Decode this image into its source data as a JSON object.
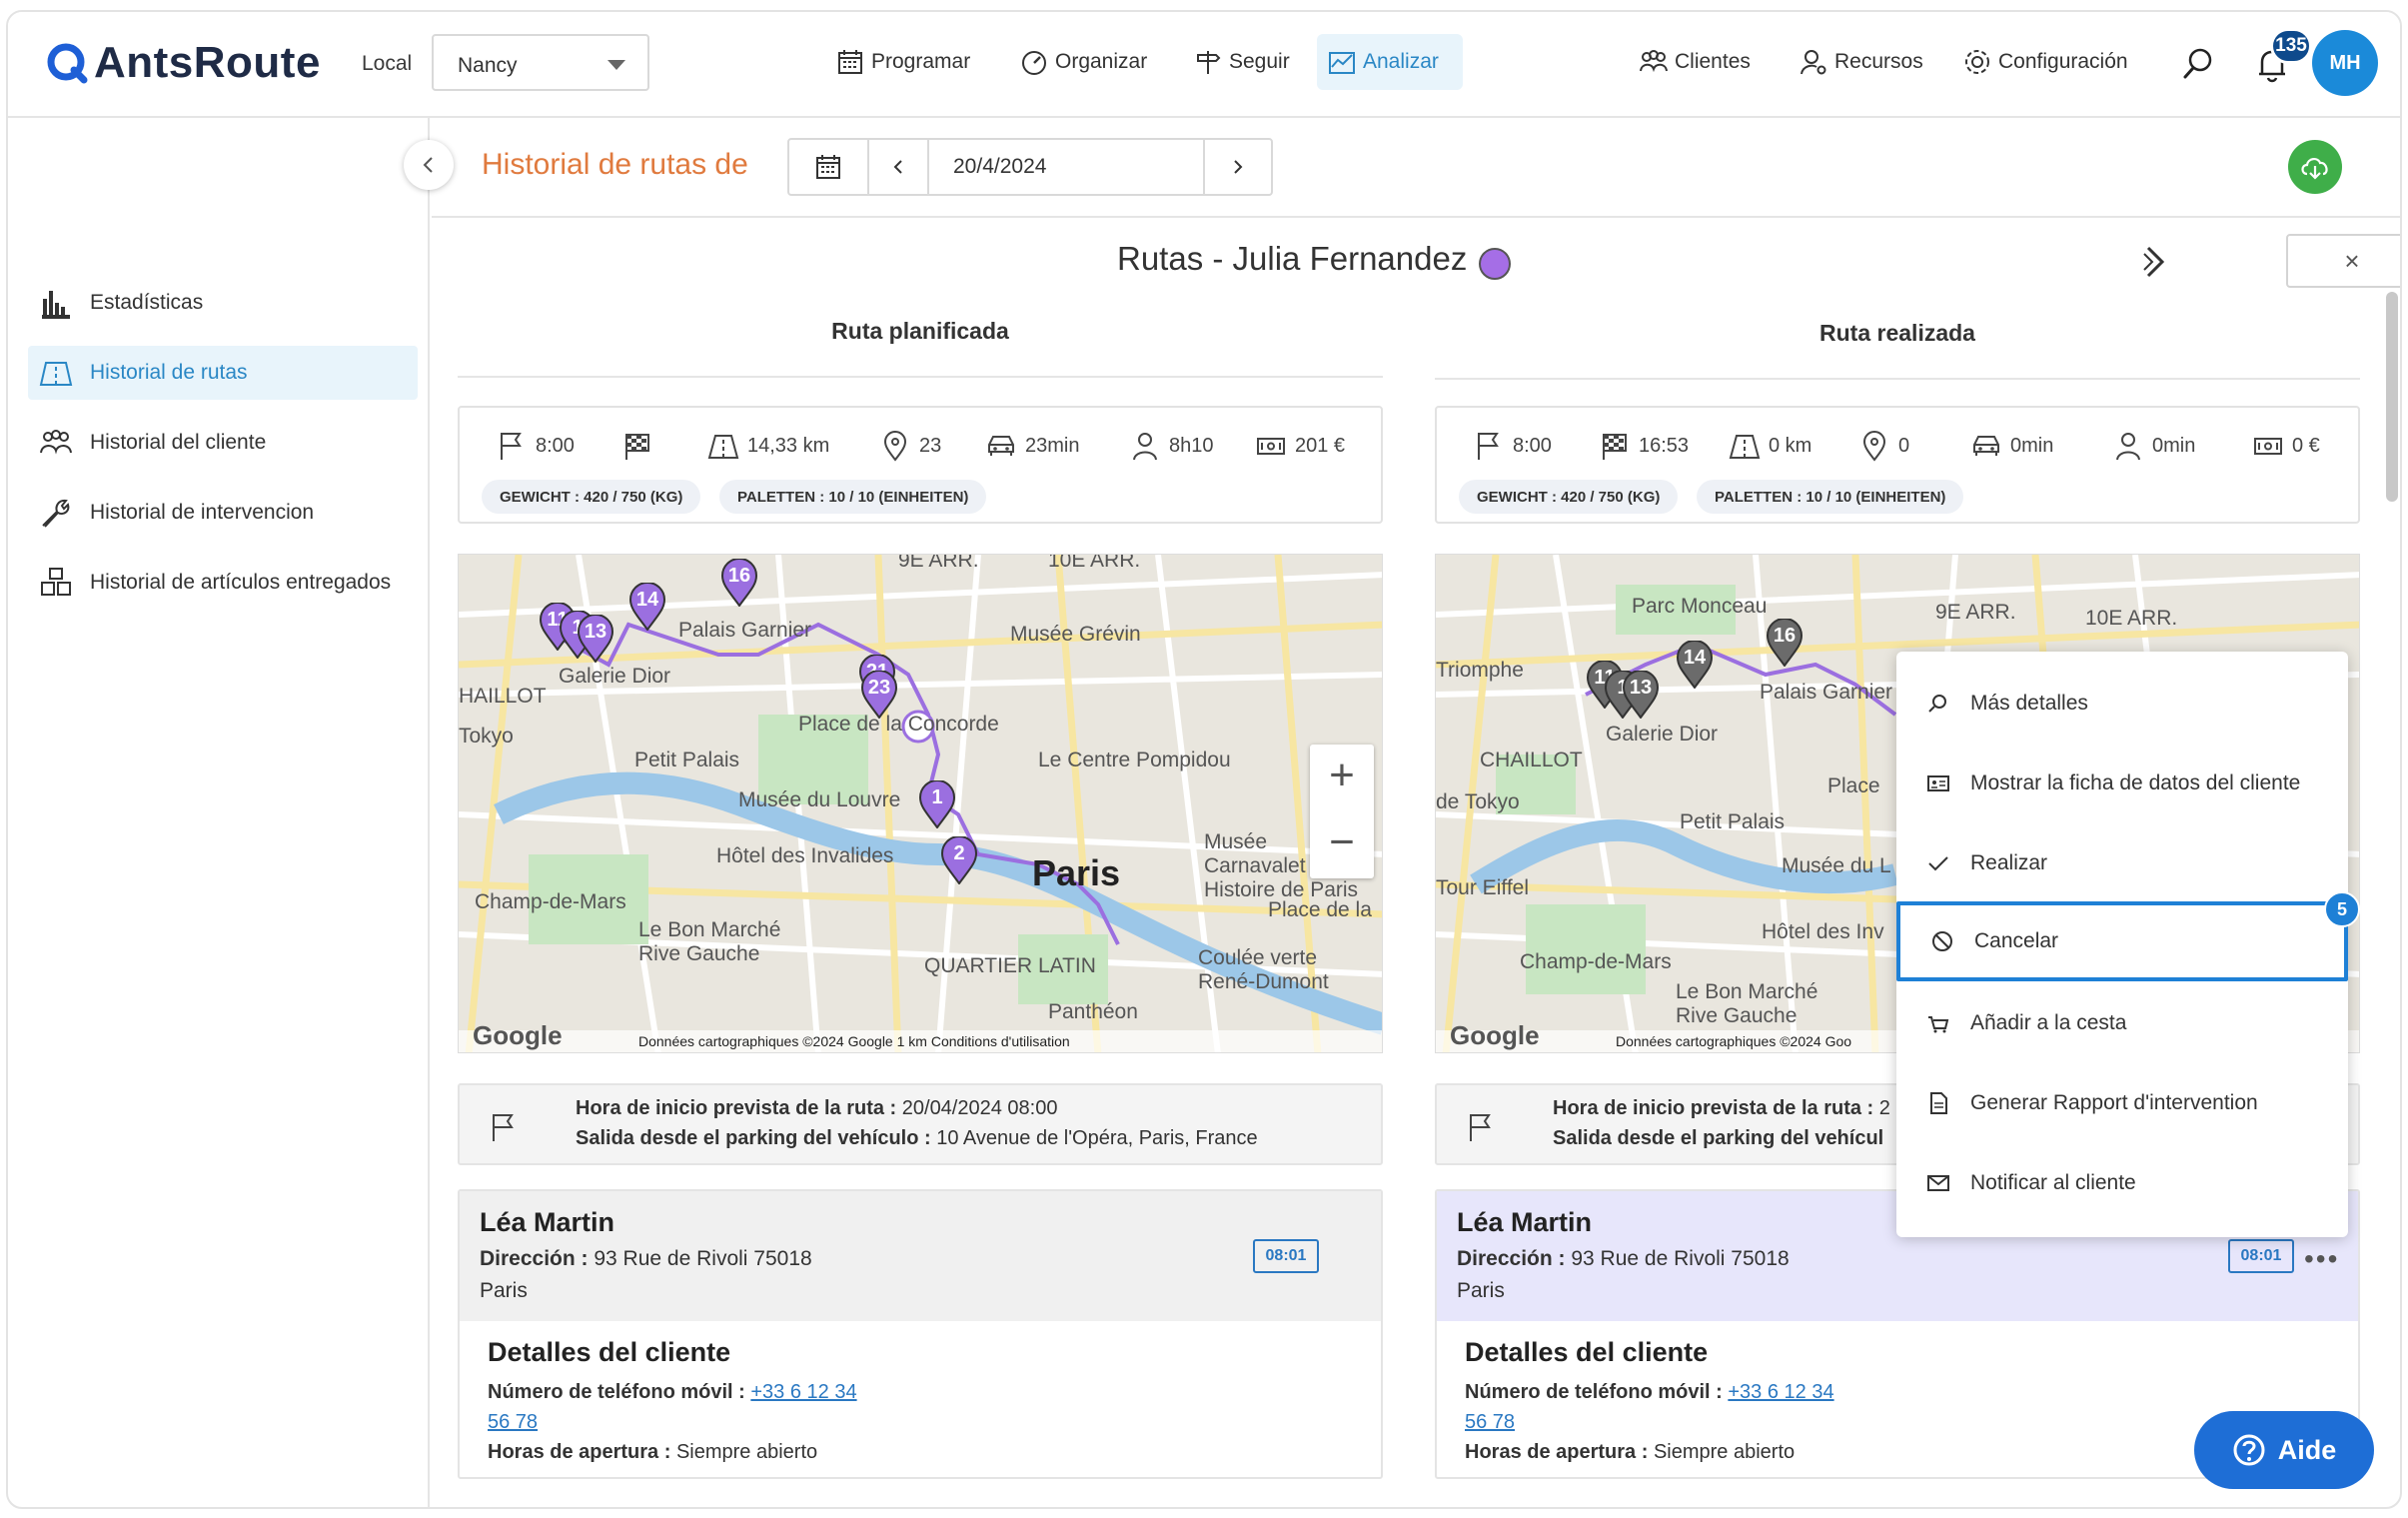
{
  "app": {
    "logo": "AntsRoute",
    "brand_color": "#2a87c5"
  },
  "header": {
    "local_label": "Local",
    "local_value": "Nancy",
    "nav": [
      {
        "label": "Programar",
        "icon": "calendar-icon"
      },
      {
        "label": "Organizar",
        "icon": "speedometer-icon"
      },
      {
        "label": "Seguir",
        "icon": "signpost-icon"
      },
      {
        "label": "Analizar",
        "icon": "chart-icon"
      }
    ],
    "right_nav": [
      {
        "label": "Clientes",
        "icon": "people-icon"
      },
      {
        "label": "Recursos",
        "icon": "user-gear-icon"
      },
      {
        "label": "Configuración",
        "icon": "gear-icon"
      }
    ],
    "notifications_count": "135",
    "avatar_initials": "MH"
  },
  "sidebar": {
    "items": [
      {
        "label": "Estadísticas"
      },
      {
        "label": "Historial de rutas"
      },
      {
        "label": "Historial del cliente"
      },
      {
        "label": "Historial de intervencion"
      },
      {
        "label": "Historial de artículos entregados"
      }
    ]
  },
  "subheader": {
    "title": "Historial de rutas de",
    "date": "20/4/2024"
  },
  "route": {
    "title": "Rutas - Julia Fernandez",
    "driver_color": "#a56ee6"
  },
  "planned": {
    "heading": "Ruta planificada",
    "stats": {
      "start": "8:00",
      "end": "",
      "distance": "14,33 km",
      "stops": "23",
      "drive": "23min",
      "work": "8h10",
      "cost": "201 €"
    },
    "chips": [
      "GEWICHT : 420 / 750 (KG)",
      "PALETTEN : 10 / 10 (EINHEITEN)"
    ],
    "map_footer": "Données cartographiques ©2024 Google   1 km          Conditions d'utilisation",
    "start_line1_label": "Hora de inicio prevista de la ruta :",
    "start_line1_value": " 20/04/2024 08:00",
    "start_line2_label": "Salida desde el parking del vehículo :",
    "start_line2_value": " 10 Avenue de l'Opéra, Paris, France"
  },
  "realized": {
    "heading": "Ruta realizada",
    "stats": {
      "start": "8:00",
      "end": "16:53",
      "distance": "0 km",
      "stops": "0",
      "drive": "0min",
      "work": "0min",
      "cost": "0 €"
    },
    "chips": [
      "GEWICHT : 420 / 750 (KG)",
      "PALETTEN : 10 / 10 (EINHEITEN)"
    ],
    "map_footer": "Données cartographiques ©2024 Goo",
    "start_line1_label": "Hora de inicio prevista de la ruta :",
    "start_line1_value": " 2",
    "start_line2_label": "Salida desde el parking del vehícul",
    "start_line2_value": ""
  },
  "map_labels": {
    "planned": [
      "9E ARR.",
      "10E ARR.",
      "Palais Garnier",
      "Musée Grévin",
      "Galerie Dior",
      "HAILLOT",
      "Tokyo",
      "Place de la Concorde",
      "Le Centre Pompidou",
      "Petit Palais",
      "Musée du Louvre",
      "Hôtel des Invalides",
      "Paris",
      "Champ-de-Mars",
      "Le Bon Marché Rive Gauche",
      "QUARTIER LATIN",
      "Coulée verte René-Dumont",
      "Panthéon",
      "Musée Carnavalet - Histoire de Paris",
      "Place de la"
    ],
    "realized": [
      "Parc Monceau",
      "9E ARR.",
      "10E ARR.",
      "Triomphe",
      "CHAILLOT",
      "Palais Garnier",
      "Galerie Dior",
      "de Tokyo",
      "Petit Palais",
      "Tour Eiffel",
      "Musée du L",
      "Hôtel des Inv",
      "Champ-de-Mars",
      "Le Bon Marché Rive Gauche",
      "Place"
    ],
    "planned_markers": [
      "11",
      "1",
      "13",
      "14",
      "16",
      "21",
      "23",
      "1",
      "2"
    ],
    "realized_markers": [
      "11",
      "1",
      "13",
      "14",
      "16"
    ]
  },
  "client": {
    "name": "Léa Martin",
    "address_label": "Dirección :",
    "address_value": " 93 Rue de Rivoli 75018",
    "city": "Paris",
    "time": "08:01",
    "details_title": "Detalles del cliente",
    "phone_label": "Número de teléfono móvil :",
    "phone_part1": "+33 6 12 34",
    "phone_part2": "56 78",
    "hours_label": "Horas de apertura :",
    "hours_value": " Siempre abierto"
  },
  "context_menu": {
    "items": [
      {
        "label": "Más detalles",
        "icon": "search-icon"
      },
      {
        "label": "Mostrar la ficha de datos del cliente",
        "icon": "id-card-icon"
      },
      {
        "label": "Realizar",
        "icon": "check-icon"
      },
      {
        "label": "Cancelar",
        "icon": "ban-icon"
      },
      {
        "label": "Añadir a la cesta",
        "icon": "basket-icon"
      },
      {
        "label": "Generar Rapport d'intervention",
        "icon": "document-icon"
      },
      {
        "label": "Notificar al cliente",
        "icon": "mail-icon"
      }
    ],
    "step_badge": "5"
  },
  "help_button": "Aide",
  "colors": {
    "route_purple": "#9b6fe0",
    "marker_grey": "#6b6b6b",
    "accent_blue": "#1e80d6",
    "title_orange": "#e07a3e"
  }
}
